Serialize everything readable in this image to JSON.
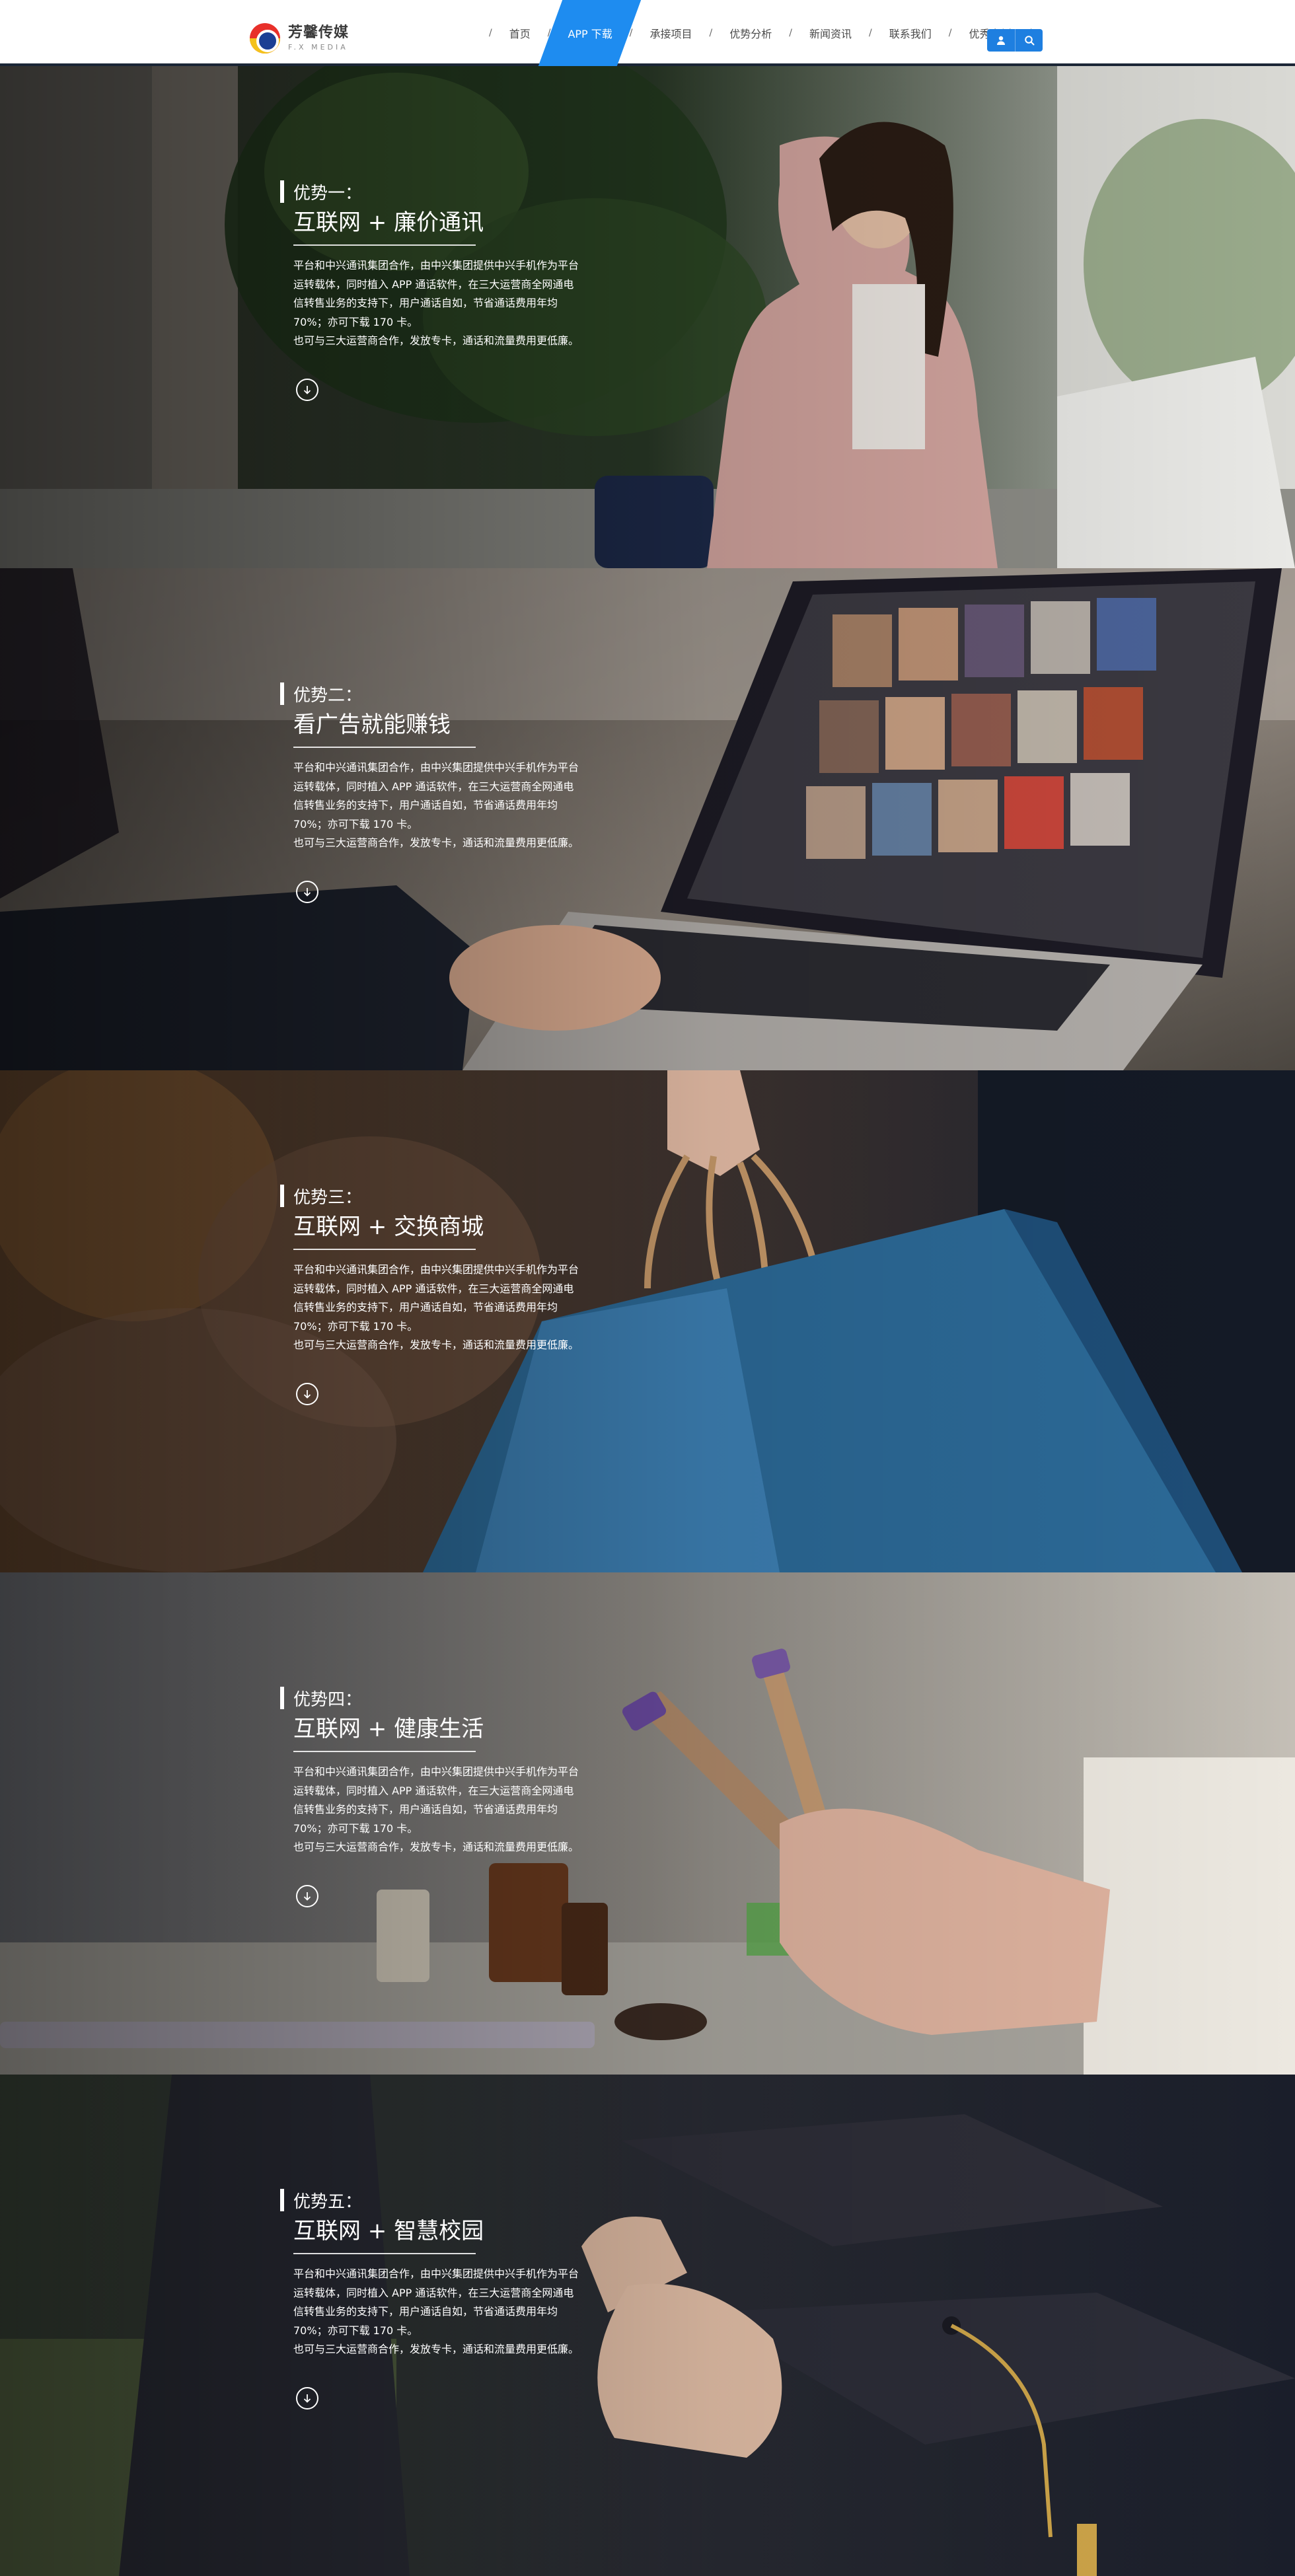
{
  "header": {
    "logo": {
      "name": "芳馨传媒",
      "tagline": "F.X MEDIA"
    },
    "nav": [
      {
        "label": "首页",
        "active": false
      },
      {
        "label": "APP 下载",
        "active": true
      },
      {
        "label": "承接项目",
        "active": false
      },
      {
        "label": "优势分析",
        "active": false
      },
      {
        "label": "新闻资讯",
        "active": false
      },
      {
        "label": "联系我们",
        "active": false
      },
      {
        "label": "优秀案例",
        "active": false
      }
    ],
    "separator": "/",
    "icons": [
      "user-icon",
      "search-icon"
    ],
    "accent": "#1e8cf0"
  },
  "sections": [
    {
      "label": "优势一：",
      "title": "互联网 + 廉价通讯",
      "lines": [
        "平台和中兴通讯集团合作，由中兴集团提供中兴手机作为平台",
        "运转载体，同时植入 APP 通话软件，在三大运营商全网通电",
        "信转售业务的支持下，用户通话自如，节省通话费用年均",
        "70%；亦可下载 170 卡。",
        "也可与三大运营商合作，发放专卡，通话和流量费用更低廉。"
      ],
      "icon": "arrow-down-circle-icon"
    },
    {
      "label": "优势二：",
      "title": "看广告就能赚钱",
      "lines": [
        "平台和中兴通讯集团合作，由中兴集团提供中兴手机作为平台",
        "运转载体，同时植入 APP 通话软件，在三大运营商全网通电",
        "信转售业务的支持下，用户通话自如，节省通话费用年均",
        "70%；亦可下载 170 卡。",
        "也可与三大运营商合作，发放专卡，通话和流量费用更低廉。"
      ],
      "icon": "arrow-down-circle-icon"
    },
    {
      "label": "优势三：",
      "title": "互联网 + 交换商城",
      "lines": [
        "平台和中兴通讯集团合作，由中兴集团提供中兴手机作为平台",
        "运转载体，同时植入 APP 通话软件，在三大运营商全网通电",
        "信转售业务的支持下，用户通话自如，节省通话费用年均",
        "70%；亦可下载 170 卡。",
        "也可与三大运营商合作，发放专卡，通话和流量费用更低廉。"
      ],
      "icon": "arrow-down-circle-icon"
    },
    {
      "label": "优势四：",
      "title": "互联网 + 健康生活",
      "lines": [
        "平台和中兴通讯集团合作，由中兴集团提供中兴手机作为平台",
        "运转载体，同时植入 APP 通话软件，在三大运营商全网通电",
        "信转售业务的支持下，用户通话自如，节省通话费用年均",
        "70%；亦可下载 170 卡。",
        "也可与三大运营商合作，发放专卡，通话和流量费用更低廉。"
      ],
      "icon": "arrow-down-circle-icon"
    },
    {
      "label": "优势五：",
      "title": "互联网 + 智慧校园",
      "lines": [
        "平台和中兴通讯集团合作，由中兴集团提供中兴手机作为平台",
        "运转载体，同时植入 APP 通话软件，在三大运营商全网通电",
        "信转售业务的支持下，用户通话自如，节省通话费用年均",
        "70%；亦可下载 170 卡。",
        "也可与三大运营商合作，发放专卡，通话和流量费用更低廉。"
      ],
      "icon": "arrow-down-circle-icon"
    }
  ]
}
